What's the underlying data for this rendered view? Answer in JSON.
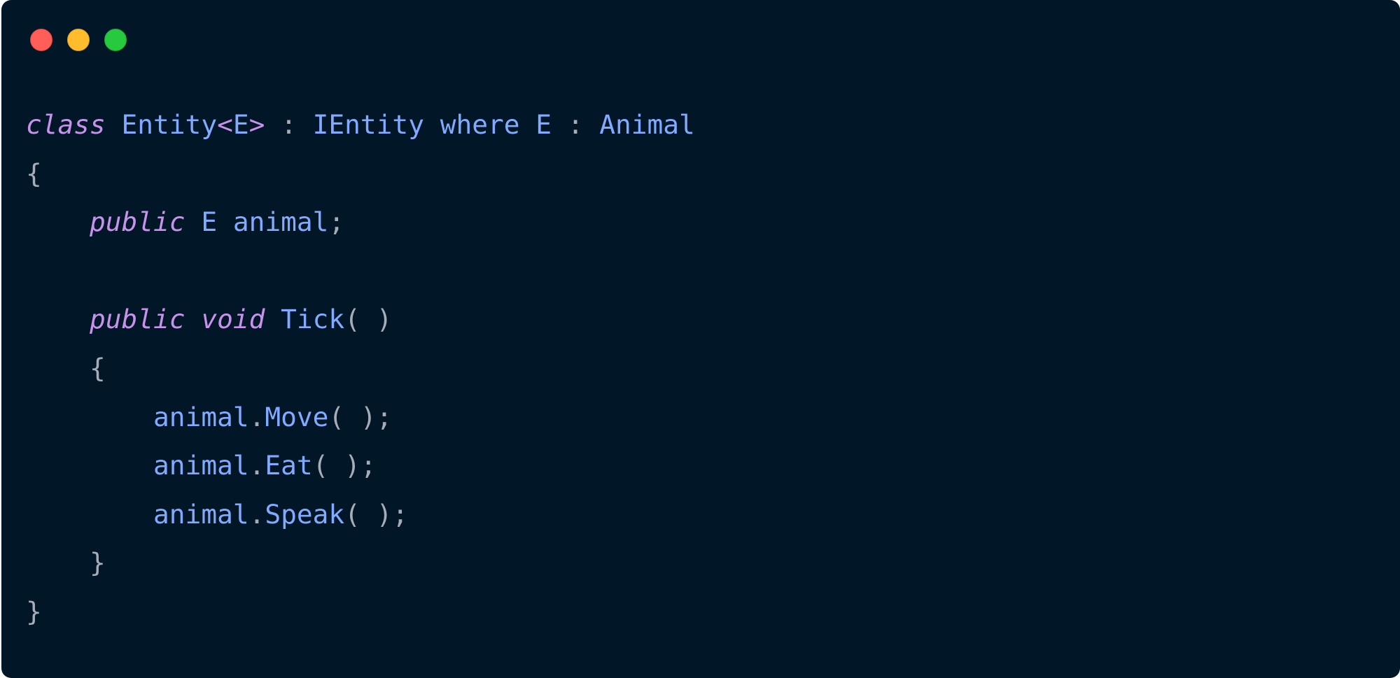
{
  "window": {
    "background": "#011627",
    "traffic_lights": [
      {
        "name": "close",
        "color": "#ff5f56"
      },
      {
        "name": "minimize",
        "color": "#ffbd2e"
      },
      {
        "name": "zoom",
        "color": "#27c93f"
      }
    ]
  },
  "code": {
    "language": "csharp",
    "colors": {
      "keyword": "#c792ea",
      "identifier": "#82aaff",
      "punctuation": "#a6adb8"
    },
    "lines": [
      [
        {
          "t": "kw",
          "v": "class"
        },
        {
          "t": "id",
          "v": " Entity"
        },
        {
          "t": "op",
          "v": "<"
        },
        {
          "t": "id",
          "v": "E"
        },
        {
          "t": "op",
          "v": ">"
        },
        {
          "t": "pn",
          "v": " : "
        },
        {
          "t": "id",
          "v": "IEntity where E "
        },
        {
          "t": "pn",
          "v": ":"
        },
        {
          "t": "id",
          "v": " Animal"
        }
      ],
      [
        {
          "t": "pn",
          "v": "{"
        }
      ],
      [
        {
          "t": "pn",
          "v": "    "
        },
        {
          "t": "kw",
          "v": "public"
        },
        {
          "t": "id",
          "v": " E animal"
        },
        {
          "t": "pn",
          "v": ";"
        }
      ],
      [],
      [
        {
          "t": "pn",
          "v": "    "
        },
        {
          "t": "kw",
          "v": "public"
        },
        {
          "t": "pn",
          "v": " "
        },
        {
          "t": "kw",
          "v": "void"
        },
        {
          "t": "id",
          "v": " Tick"
        },
        {
          "t": "pn",
          "v": "( )"
        }
      ],
      [
        {
          "t": "pn",
          "v": "    {"
        }
      ],
      [
        {
          "t": "pn",
          "v": "        "
        },
        {
          "t": "id",
          "v": "animal"
        },
        {
          "t": "pn",
          "v": "."
        },
        {
          "t": "id",
          "v": "Move"
        },
        {
          "t": "pn",
          "v": "( );"
        }
      ],
      [
        {
          "t": "pn",
          "v": "        "
        },
        {
          "t": "id",
          "v": "animal"
        },
        {
          "t": "pn",
          "v": "."
        },
        {
          "t": "id",
          "v": "Eat"
        },
        {
          "t": "pn",
          "v": "( );"
        }
      ],
      [
        {
          "t": "pn",
          "v": "        "
        },
        {
          "t": "id",
          "v": "animal"
        },
        {
          "t": "pn",
          "v": "."
        },
        {
          "t": "id",
          "v": "Speak"
        },
        {
          "t": "pn",
          "v": "( );"
        }
      ],
      [
        {
          "t": "pn",
          "v": "    }"
        }
      ],
      [
        {
          "t": "pn",
          "v": "}"
        }
      ]
    ]
  }
}
